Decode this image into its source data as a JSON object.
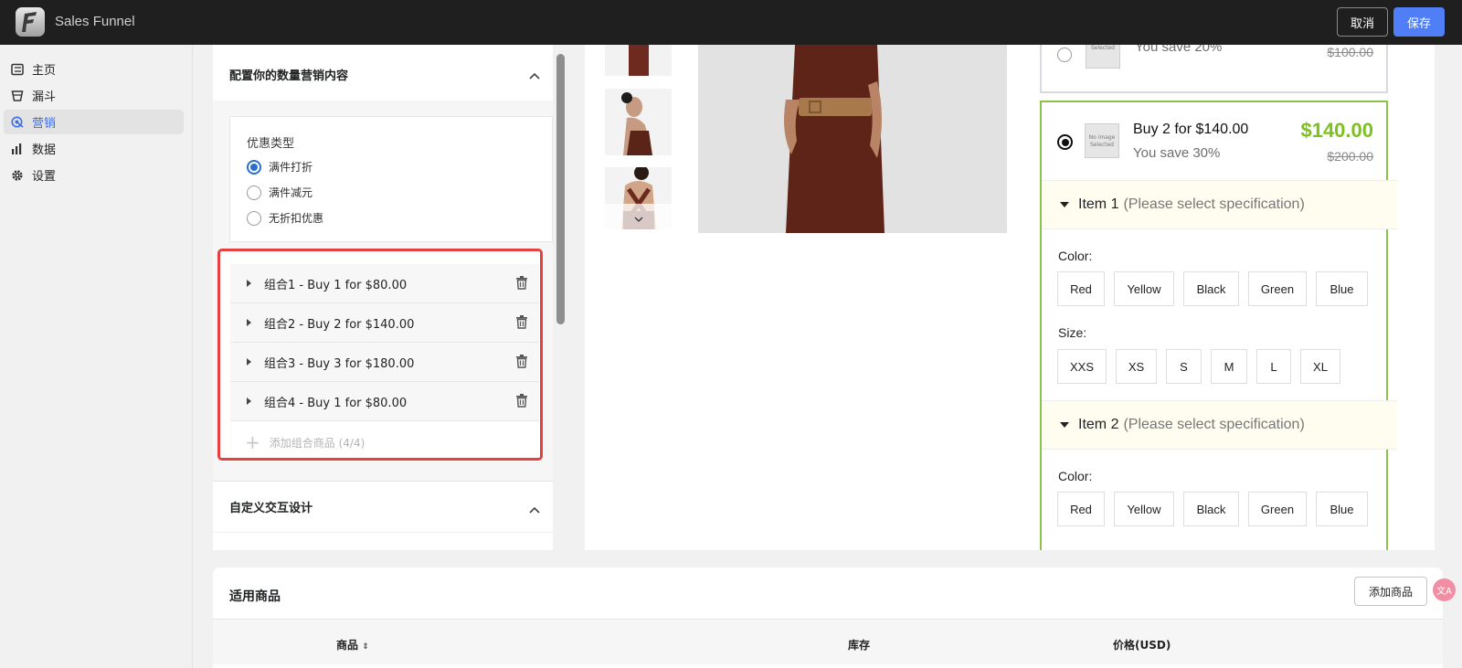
{
  "app": {
    "title": "Sales Funnel"
  },
  "topbar": {
    "cancel_label": "取消",
    "save_label": "保存"
  },
  "sidebar": {
    "items": [
      {
        "label": "主页",
        "icon": "list-icon",
        "active": false
      },
      {
        "label": "漏斗",
        "icon": "funnel-icon",
        "active": false
      },
      {
        "label": "营销",
        "icon": "marketing-icon",
        "active": true
      },
      {
        "label": "数据",
        "icon": "bar-chart-icon",
        "active": false
      },
      {
        "label": "设置",
        "icon": "gear-icon",
        "active": false
      }
    ]
  },
  "config": {
    "section_title": "配置你的数量营销内容",
    "discount": {
      "title": "优惠类型",
      "options": [
        {
          "label": "满件打折",
          "selected": true
        },
        {
          "label": "满件减元",
          "selected": false
        },
        {
          "label": "无折扣优惠",
          "selected": false
        }
      ]
    },
    "bundles": [
      {
        "label": "组合1 - Buy 1 for $80.00"
      },
      {
        "label": "组合2 - Buy 2 for $140.00"
      },
      {
        "label": "组合3 - Buy 3 for $180.00"
      },
      {
        "label": "组合4 - Buy 1 for $80.00"
      }
    ],
    "add_bundle_label": "添加组合商品 (4/4)",
    "custom_section_title": "自定义交互设计"
  },
  "preview": {
    "offer_top": {
      "image_text": "Selected",
      "save_text": "You save 20%",
      "old_price": "$100.00"
    },
    "offer_selected": {
      "image_text": "No image Selected",
      "title": "Buy 2 for $140.00",
      "save_text": "You save 30%",
      "price": "$140.00",
      "old_price": "$200.00"
    },
    "item1": {
      "name": "Item 1",
      "hint": "(Please select specification)",
      "color_label": "Color:",
      "colors": [
        "Red",
        "Yellow",
        "Black",
        "Green",
        "Blue"
      ],
      "size_label": "Size:",
      "sizes": [
        "XXS",
        "XS",
        "S",
        "M",
        "L",
        "XL"
      ]
    },
    "item2": {
      "name": "Item 2",
      "hint": "(Please select specification)",
      "color_label": "Color:",
      "colors": [
        "Red",
        "Yellow",
        "Black",
        "Green",
        "Blue"
      ]
    },
    "accent_color": "#7cc11f"
  },
  "products": {
    "title": "适用商品",
    "add_label": "添加商品",
    "columns": {
      "product": "商品",
      "stock": "库存",
      "price": "价格(USD)"
    }
  },
  "fab": {
    "label": "文A"
  }
}
